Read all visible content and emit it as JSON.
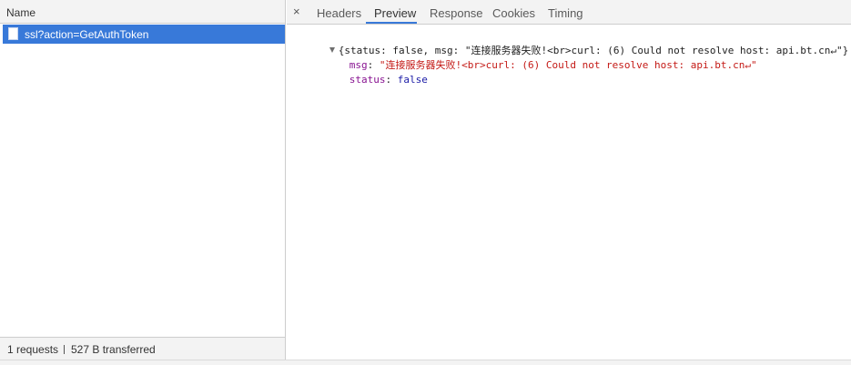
{
  "left_panel": {
    "header": "Name",
    "requests": [
      {
        "name": "ssl?action=GetAuthToken",
        "selected": true
      }
    ],
    "footer": {
      "requests": "1 requests",
      "transferred": "527 B transferred"
    }
  },
  "right_panel": {
    "close_glyph": "×",
    "tabs": [
      {
        "label": "Headers",
        "active": false
      },
      {
        "label": "Preview",
        "active": true
      },
      {
        "label": "Response",
        "active": false
      },
      {
        "label": "Cookies",
        "active": false
      },
      {
        "label": "Timing",
        "active": false
      }
    ],
    "preview": {
      "summary": "{status: false, msg: \"连接服务器失败!<br>curl: (6) Could not resolve host: api.bt.cn↵\"}",
      "properties": [
        {
          "key": "msg",
          "value": "\"连接服务器失败!<br>curl: (6) Could not resolve host: api.bt.cn↵\"",
          "type": "string"
        },
        {
          "key": "status",
          "value": "false",
          "type": "boolean"
        }
      ]
    }
  },
  "colors": {
    "selection": "#3879d9",
    "key": "#881391",
    "string": "#c41a16",
    "boolean": "#1a1aa6"
  },
  "icons": {
    "close": "close-icon",
    "expand": "triangle-down-icon",
    "file": "file-icon"
  }
}
